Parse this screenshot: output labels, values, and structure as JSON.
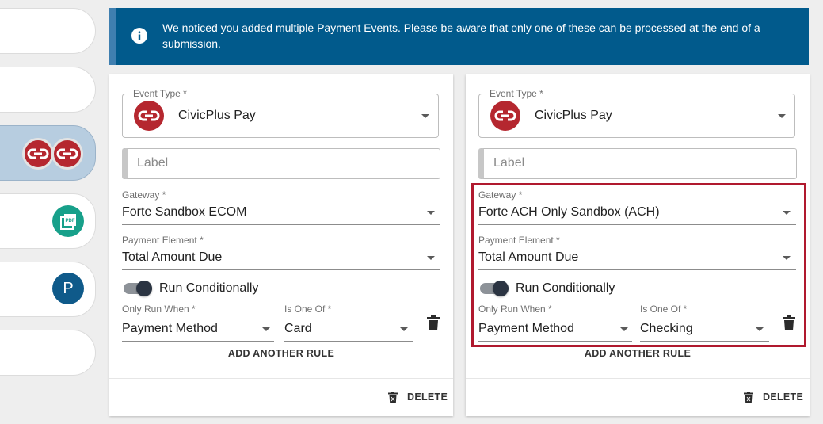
{
  "banner": {
    "icon": "info-icon",
    "message": "We noticed you added multiple Payment Events. Please be aware that only one of these can be processed at the end of a submission.",
    "color": "#015a8c"
  },
  "sidebar": {
    "items": [
      {
        "icon": null
      },
      {
        "icon": null
      },
      {
        "icon": "civicplus-pay-logo",
        "active": true
      },
      {
        "icon": "pdf-icon",
        "icon_text": "PDF"
      },
      {
        "icon": "p-icon",
        "icon_text": "P"
      },
      {
        "icon": null
      }
    ]
  },
  "cards": [
    {
      "event_type_label": "Event Type *",
      "event_type_value": "CivicPlus Pay",
      "label_placeholder": "Label",
      "gateway_label": "Gateway *",
      "gateway_value": "Forte Sandbox ECOM",
      "payment_element_label": "Payment Element *",
      "payment_element_value": "Total Amount Due",
      "run_conditionally_label": "Run Conditionally",
      "run_conditionally_on": true,
      "only_run_when_label": "Only Run When *",
      "only_run_when_value": "Payment Method",
      "is_one_of_label": "Is One Of *",
      "is_one_of_value": "Card",
      "add_rule_label": "ADD ANOTHER RULE",
      "delete_label": "DELETE"
    },
    {
      "event_type_label": "Event Type *",
      "event_type_value": "CivicPlus Pay",
      "label_placeholder": "Label",
      "gateway_label": "Gateway *",
      "gateway_value": "Forte ACH Only Sandbox (ACH)",
      "payment_element_label": "Payment Element *",
      "payment_element_value": "Total Amount Due",
      "run_conditionally_label": "Run Conditionally",
      "run_conditionally_on": true,
      "only_run_when_label": "Only Run When *",
      "only_run_when_value": "Payment Method",
      "is_one_of_label": "Is One Of *",
      "is_one_of_value": "Checking",
      "add_rule_label": "ADD ANOTHER RULE",
      "delete_label": "DELETE",
      "highlighted": true
    }
  ],
  "colors": {
    "brand_red": "#b5272f",
    "highlight": "#b0192e",
    "toggle_knob": "#2b3442"
  }
}
